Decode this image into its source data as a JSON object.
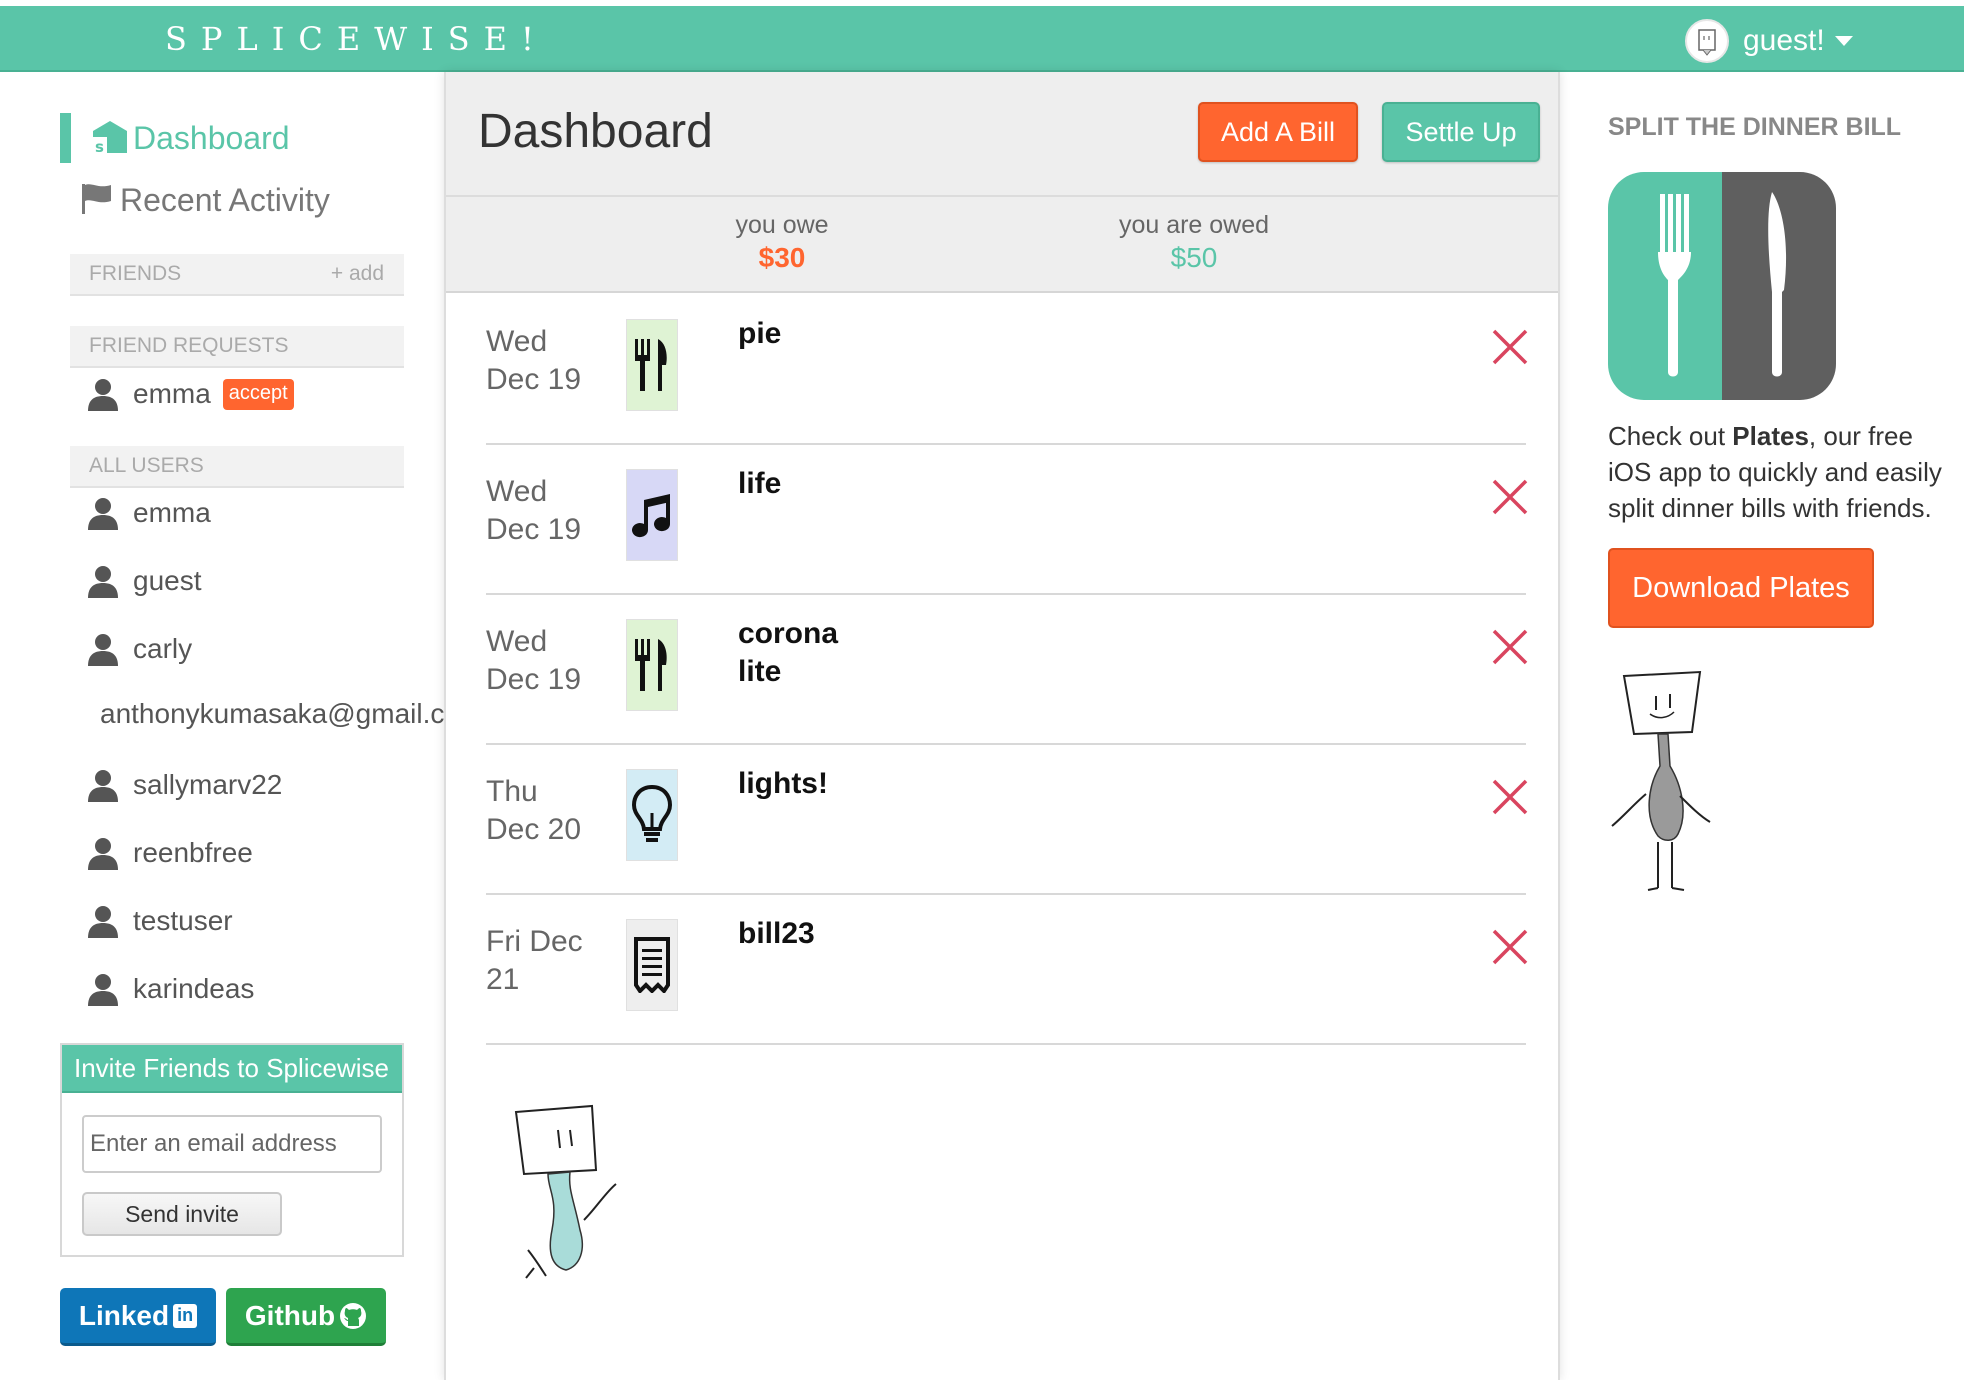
{
  "app": {
    "brand": "SPLICEWISE!"
  },
  "user_menu": {
    "name": "guest!",
    "avatar_icon": "chef-avatar-icon",
    "caret_icon": "caret-down-icon"
  },
  "nav": {
    "dashboard": {
      "label": "Dashboard",
      "icon": "splicewise-logo-icon"
    },
    "recent_activity": {
      "label": "Recent Activity",
      "icon": "flag-icon"
    }
  },
  "friends": {
    "title": "FRIENDS",
    "add_label": "+ add"
  },
  "friend_requests": {
    "title": "FRIEND REQUESTS",
    "items": [
      {
        "name": "emma",
        "action": "accept"
      }
    ]
  },
  "all_users": {
    "title": "ALL USERS",
    "items": [
      {
        "name": "emma"
      },
      {
        "name": "guest"
      },
      {
        "name": "carly"
      },
      {
        "name": "anthonykumasaka@gmail.com"
      },
      {
        "name": "sallymarv22"
      },
      {
        "name": "reenbfree"
      },
      {
        "name": "testuser"
      },
      {
        "name": "karindeas"
      }
    ]
  },
  "invite": {
    "title": "Invite Friends to Splicewise",
    "placeholder": "Enter an email address",
    "send_label": "Send invite"
  },
  "social": {
    "linkedin_label": "Linked",
    "linkedin_badge": "in",
    "github_label": "Github"
  },
  "dashboard": {
    "title": "Dashboard",
    "add_bill_label": "Add A Bill",
    "settle_up_label": "Settle Up",
    "you_owe_label": "you owe",
    "you_owe_amount": "$30",
    "you_are_owed_label": "you are owed",
    "you_are_owed_amount": "$50"
  },
  "bills": [
    {
      "date_line1": "Wed",
      "date_line2": "Dec 19",
      "name_line1": "pie",
      "name_line2": "",
      "icon": "fork-knife-icon",
      "icon_bg": "#dff3d4"
    },
    {
      "date_line1": "Wed",
      "date_line2": "Dec 19",
      "name_line1": "life",
      "name_line2": "",
      "icon": "music-note-icon",
      "icon_bg": "#d7d8f6"
    },
    {
      "date_line1": "Wed",
      "date_line2": "Dec 19",
      "name_line1": "corona",
      "name_line2": "lite",
      "icon": "fork-knife-icon",
      "icon_bg": "#dff3d4"
    },
    {
      "date_line1": "Thu",
      "date_line2": "Dec 20",
      "name_line1": "lights!",
      "name_line2": "",
      "icon": "light-bulb-icon",
      "icon_bg": "#d3ecf5"
    },
    {
      "date_line1": "Fri Dec",
      "date_line2": "21",
      "name_line1": "bill23",
      "name_line2": "",
      "icon": "receipt-icon",
      "icon_bg": "#eeeeee"
    }
  ],
  "promo": {
    "title": "SPLIT THE DINNER BILL",
    "text_prefix": "Check out ",
    "text_bold": "Plates",
    "text_suffix": ", our free iOS app to quickly and easily split dinner bills with friends.",
    "download_label": "Download Plates"
  },
  "colors": {
    "accent": "#5ac5a8",
    "orange": "#ff652f",
    "delete": "#d9455f",
    "linkedin": "#0e76b8",
    "github": "#2ea44f"
  }
}
